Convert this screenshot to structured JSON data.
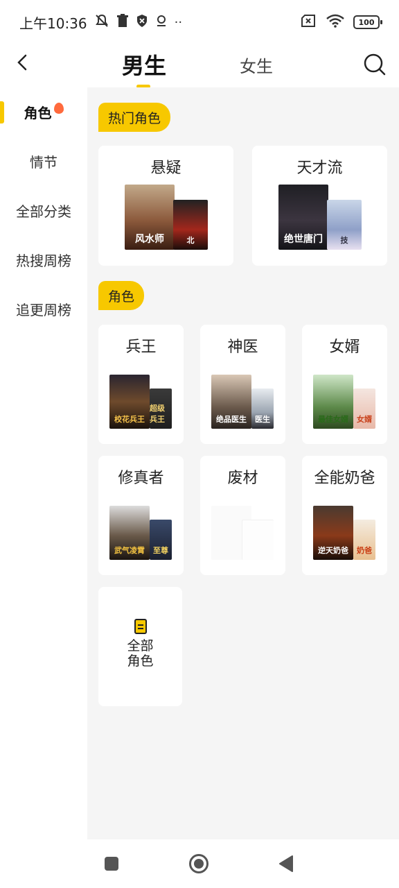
{
  "status_bar": {
    "time": "上午10:36",
    "more": "··",
    "battery": "100"
  },
  "header": {
    "tabs": [
      {
        "label": "男生",
        "active": true
      },
      {
        "label": "女生",
        "active": false
      }
    ]
  },
  "sidebar": {
    "items": [
      {
        "label": "角色",
        "active": true
      },
      {
        "label": "情节",
        "active": false
      },
      {
        "label": "全部分类",
        "active": false
      },
      {
        "label": "热搜周榜",
        "active": false
      },
      {
        "label": "追更周榜",
        "active": false
      }
    ]
  },
  "sections": {
    "hot_roles": {
      "title": "热门角色",
      "cards": [
        {
          "title": "悬疑",
          "covers": [
            "风水师",
            "北"
          ]
        },
        {
          "title": "天才流",
          "covers": [
            "绝世唐门",
            "技"
          ]
        }
      ]
    },
    "roles": {
      "title": "角色",
      "cards": [
        {
          "title": "兵王",
          "covers": [
            "校花兵王",
            "超级兵王"
          ]
        },
        {
          "title": "神医",
          "covers": [
            "绝品医生",
            "医生"
          ]
        },
        {
          "title": "女婿",
          "covers": [
            "最佳女婿",
            "女婿"
          ]
        },
        {
          "title": "修真者",
          "covers": [
            "武气凌霄",
            "至尊"
          ]
        },
        {
          "title": "废材",
          "covers": []
        },
        {
          "title": "全能奶爸",
          "covers": [
            "逆天奶爸",
            "奶爸"
          ]
        }
      ],
      "all_label_line1": "全部",
      "all_label_line2": "角色"
    }
  },
  "colors": {
    "accent": "#f7c800",
    "content_bg": "#f5f5f5",
    "badge": "#ff6a3d"
  }
}
